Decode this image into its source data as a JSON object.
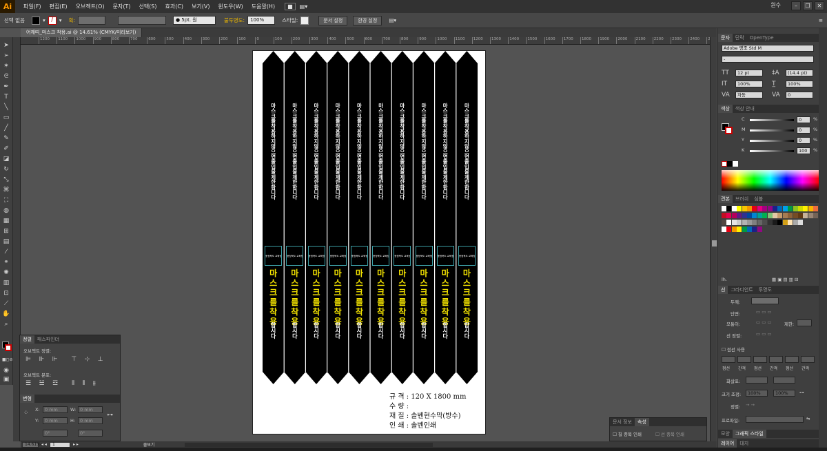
{
  "app": {
    "logo": "Ai",
    "user": "원수"
  },
  "menu": [
    "파일(F)",
    "편집(E)",
    "오브젝트(O)",
    "문자(T)",
    "선택(S)",
    "효과(C)",
    "보기(V)",
    "윈도우(W)",
    "도움말(H)"
  ],
  "control": {
    "selection": "선택 없음",
    "stroke_label": "획:",
    "brush": "● 5pt. 원",
    "opacity_label": "불투명도:",
    "opacity": "100%",
    "style_label": "스타일:",
    "doc_setup": "문서 설정",
    "prefs": "환경 설정"
  },
  "document_tab": "어깨띠_마스크 착용.ai @ 14.61% (CMYK/미리보기)",
  "ruler_ticks": [
    "1200",
    "1100",
    "1000",
    "900",
    "800",
    "700",
    "600",
    "500",
    "400",
    "300",
    "200",
    "100",
    "0",
    "100",
    "200",
    "300",
    "400",
    "500",
    "600",
    "700",
    "800",
    "900",
    "1000",
    "1100",
    "1200",
    "1300",
    "1400",
    "1500",
    "1600",
    "1700",
    "1800",
    "1900",
    "2000",
    "2100",
    "2200",
    "2300",
    "2400",
    "2500"
  ],
  "strips": {
    "count": 10,
    "white_vertical": [
      "마",
      "스",
      "크",
      "를",
      "착",
      "용",
      "하",
      "지",
      "않",
      "으",
      "면",
      "출",
      "입",
      "을",
      "제",
      "한",
      "합",
      "니",
      "다"
    ],
    "label_box": "충청북도 교육청",
    "yellow_vertical": [
      "마",
      "스",
      "크",
      "를",
      "착",
      "용"
    ],
    "small_vertical": [
      "합",
      "시",
      "다"
    ]
  },
  "specs": [
    "규 격 : 120 X 1800 mm",
    "수 량 :",
    "재 질 : 솔벤현수막(방수)",
    "인 쇄 : 솔벤인쇄"
  ],
  "char_panel": {
    "tabs": [
      "문자",
      "단락",
      "OpenType"
    ],
    "font": "Adobe 명조 Std M",
    "style": "-",
    "size": "12 pt",
    "leading": "(14.4 pt)",
    "vscale": "100%",
    "hscale": "100%",
    "kerning": "자동",
    "tracking": "0"
  },
  "color_panel": {
    "tabs": [
      "색상",
      "색상 안내"
    ],
    "channels": [
      {
        "label": "C",
        "value": "0"
      },
      {
        "label": "M",
        "value": "0"
      },
      {
        "label": "Y",
        "value": "0"
      },
      {
        "label": "K",
        "value": "100"
      }
    ],
    "pct": "%"
  },
  "swatch_panel": {
    "tabs": [
      "견본",
      "브러쉬",
      "심볼"
    ]
  },
  "stroke_panel": {
    "tabs": [
      "선",
      "그라디언트",
      "투명도"
    ],
    "weight_label": "두께:",
    "cap_label": "단면:",
    "corner_label": "모퉁이:",
    "limit_label": "제한:",
    "align_label": "선 정렬:",
    "dash_label": "점선 사용",
    "dash_cells": [
      "점선",
      "간격",
      "점선",
      "간격",
      "점선",
      "간격"
    ],
    "arrow_label": "화살표:",
    "scale_label": "크기 조정:",
    "scale_a": "100%",
    "scale_b": "100%",
    "align2_label": "정렬:",
    "profile_label": "프로파일:"
  },
  "bottom_tabs": [
    "모양",
    "그래픽 스타일"
  ],
  "layer_tabs": [
    "레이어",
    "대지"
  ],
  "align_panel": {
    "tabs": [
      "정렬",
      "패스파인더"
    ],
    "obj_align": "오브젝트 정렬:",
    "obj_dist": "오브젝트 분포:"
  },
  "transform_panel": {
    "tab": "변형",
    "x": "0 mm",
    "y": "0 mm",
    "w": "0 mm",
    "h": "0 mm",
    "angle": "0°",
    "shear": "0°"
  },
  "prop_panel": {
    "tabs": [
      "문서 정보",
      "속성"
    ],
    "fill_overprint": "칠 중복 인쇄",
    "stroke_overprint": "선 중복 인쇄"
  },
  "status": {
    "zoom": "14.61%",
    "page": "1",
    "mode": "줄보기"
  }
}
